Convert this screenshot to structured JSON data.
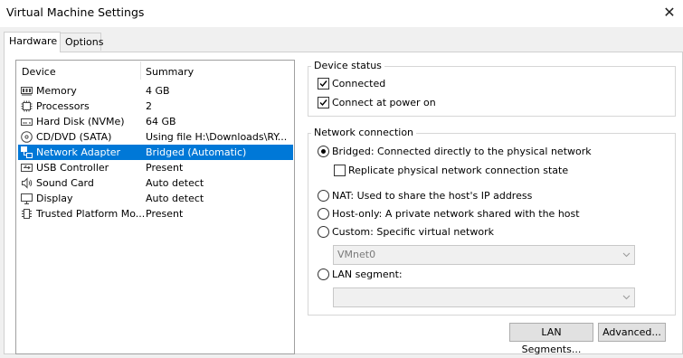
{
  "window": {
    "title": "Virtual Machine Settings",
    "close_glyph": "✕"
  },
  "tabs": [
    {
      "label": "Hardware"
    },
    {
      "label": "Options"
    }
  ],
  "device_list": {
    "col_device": "Device",
    "col_summary": "Summary",
    "items": [
      {
        "name": "Memory",
        "summary": "4 GB",
        "icon": "memory-icon"
      },
      {
        "name": "Processors",
        "summary": "2",
        "icon": "processor-icon"
      },
      {
        "name": "Hard Disk (NVMe)",
        "summary": "64 GB",
        "icon": "hard-disk-icon"
      },
      {
        "name": "CD/DVD (SATA)",
        "summary": "Using file H:\\Downloads\\RY...",
        "icon": "cd-dvd-icon"
      },
      {
        "name": "Network Adapter",
        "summary": "Bridged (Automatic)",
        "icon": "network-adapter-icon",
        "selected": true
      },
      {
        "name": "USB Controller",
        "summary": "Present",
        "icon": "usb-icon"
      },
      {
        "name": "Sound Card",
        "summary": "Auto detect",
        "icon": "speaker-icon"
      },
      {
        "name": "Display",
        "summary": "Auto detect",
        "icon": "monitor-icon"
      },
      {
        "name": "Trusted Platform Mo...",
        "summary": "Present",
        "icon": "tpm-icon"
      }
    ]
  },
  "device_status": {
    "title": "Device status",
    "connected": {
      "label": "Connected",
      "checked": true
    },
    "connect_power_on": {
      "label": "Connect at power on",
      "checked": true
    }
  },
  "network_connection": {
    "title": "Network connection",
    "bridged": {
      "label": "Bridged: Connected directly to the physical network",
      "selected": true
    },
    "replicate": {
      "label": "Replicate physical network connection state",
      "checked": false
    },
    "nat": {
      "label": "NAT: Used to share the host's IP address"
    },
    "host_only": {
      "label": "Host-only: A private network shared with the host"
    },
    "custom": {
      "label": "Custom: Specific virtual network"
    },
    "custom_select": {
      "value": "VMnet0"
    },
    "lan_segment": {
      "label": "LAN segment:"
    },
    "lan_select": {
      "value": ""
    }
  },
  "buttons": {
    "lan_segments": "LAN Segments...",
    "advanced": "Advanced..."
  },
  "colors": {
    "selection": "#0078d7",
    "background": "#f0f0f0"
  }
}
